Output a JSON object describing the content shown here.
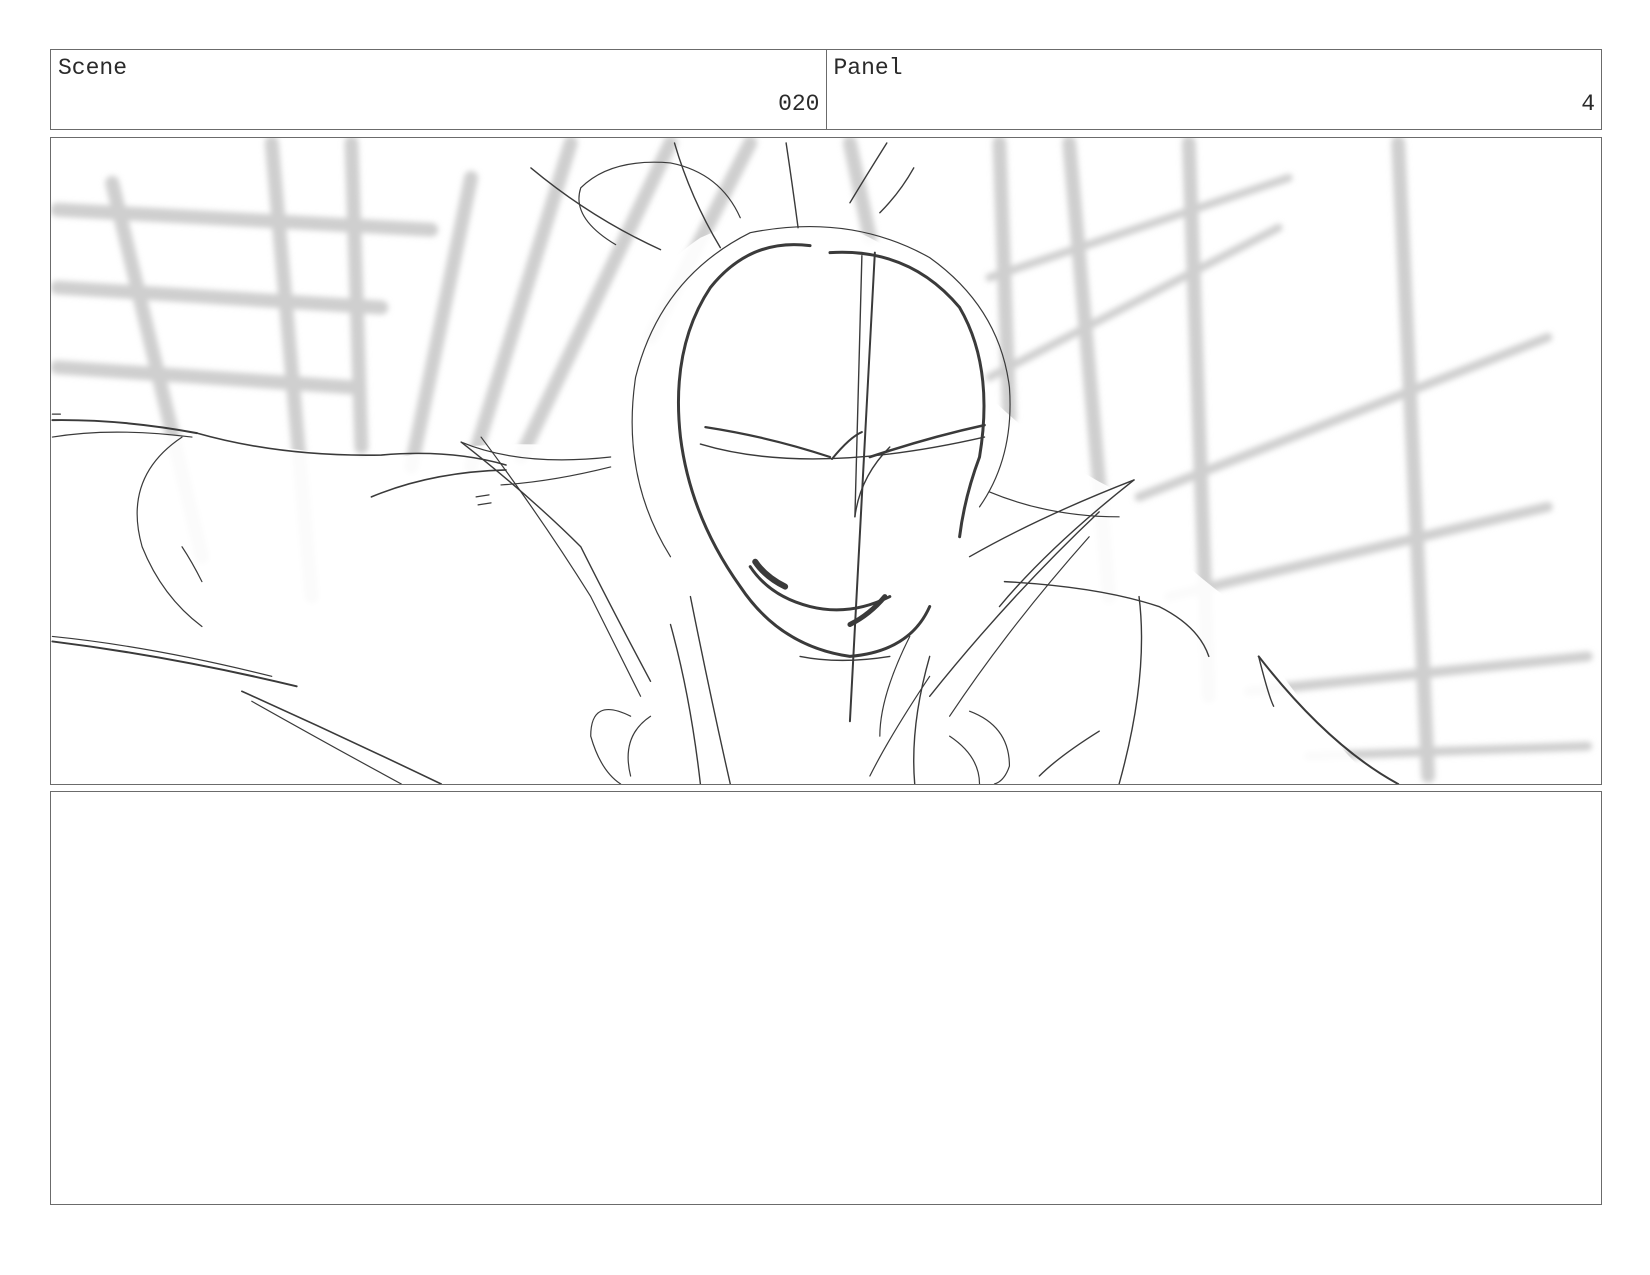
{
  "header": {
    "scene_label": "Scene",
    "scene_value": "020",
    "panel_label": "Panel",
    "panel_value": "4"
  },
  "notes": {
    "text": ""
  }
}
